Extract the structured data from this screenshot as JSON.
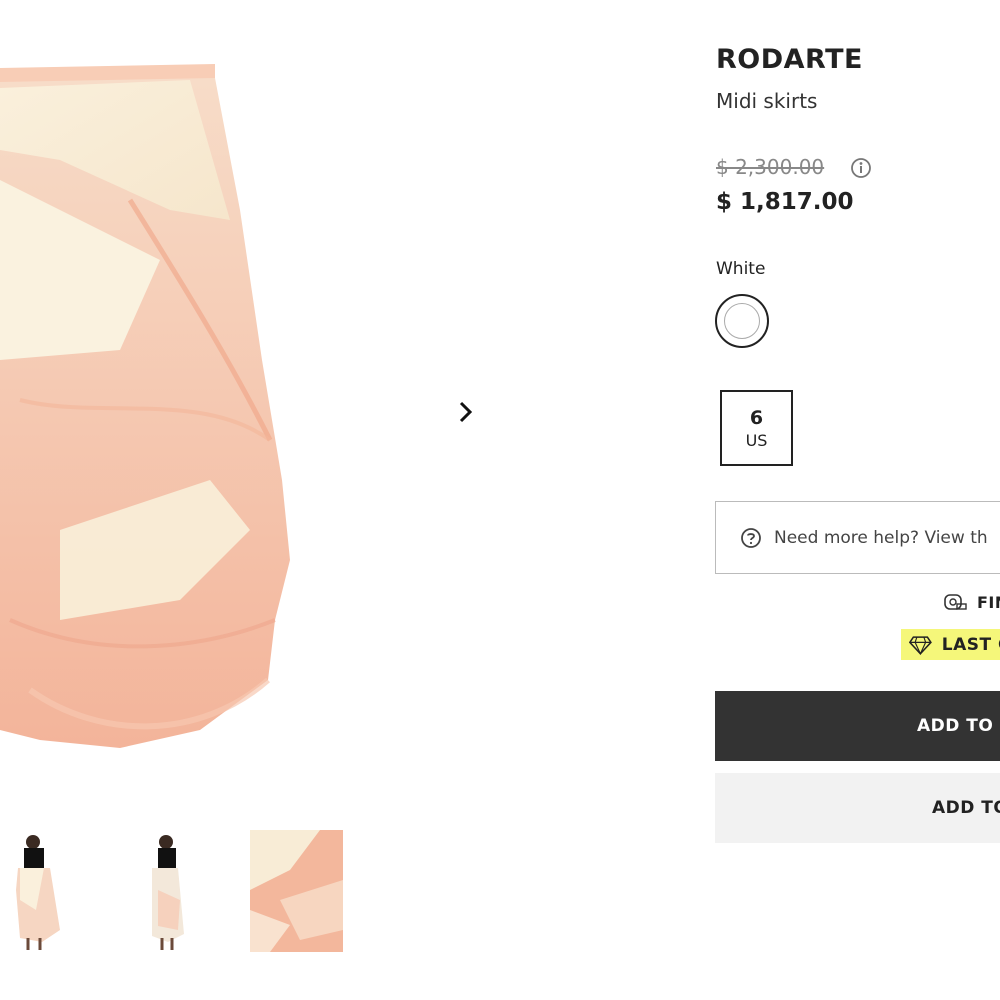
{
  "product": {
    "brand": "RODARTE",
    "category": "Midi skirts",
    "original_price": "$ 2,300.00",
    "sale_price": "$ 1,817.00",
    "color_label": "White",
    "size": {
      "value": "6",
      "unit": "US"
    }
  },
  "gallery": {
    "next_icon": "chevron-right-icon",
    "thumbnails": [
      "model-front",
      "model-side",
      "fabric-detail"
    ]
  },
  "help": {
    "text": "Need more help? View th",
    "icon": "question-circle-icon"
  },
  "fit": {
    "text": "FIN",
    "icon": "measuring-tape-icon"
  },
  "badge": {
    "text": "LAST C",
    "icon": "diamond-icon",
    "color": "#f5f77a"
  },
  "actions": {
    "add_to_bag": "ADD TO S",
    "add_to_wishlist": "ADD TO"
  },
  "colors": {
    "primary_button": "#333333",
    "secondary_button": "#f2f2f2"
  }
}
